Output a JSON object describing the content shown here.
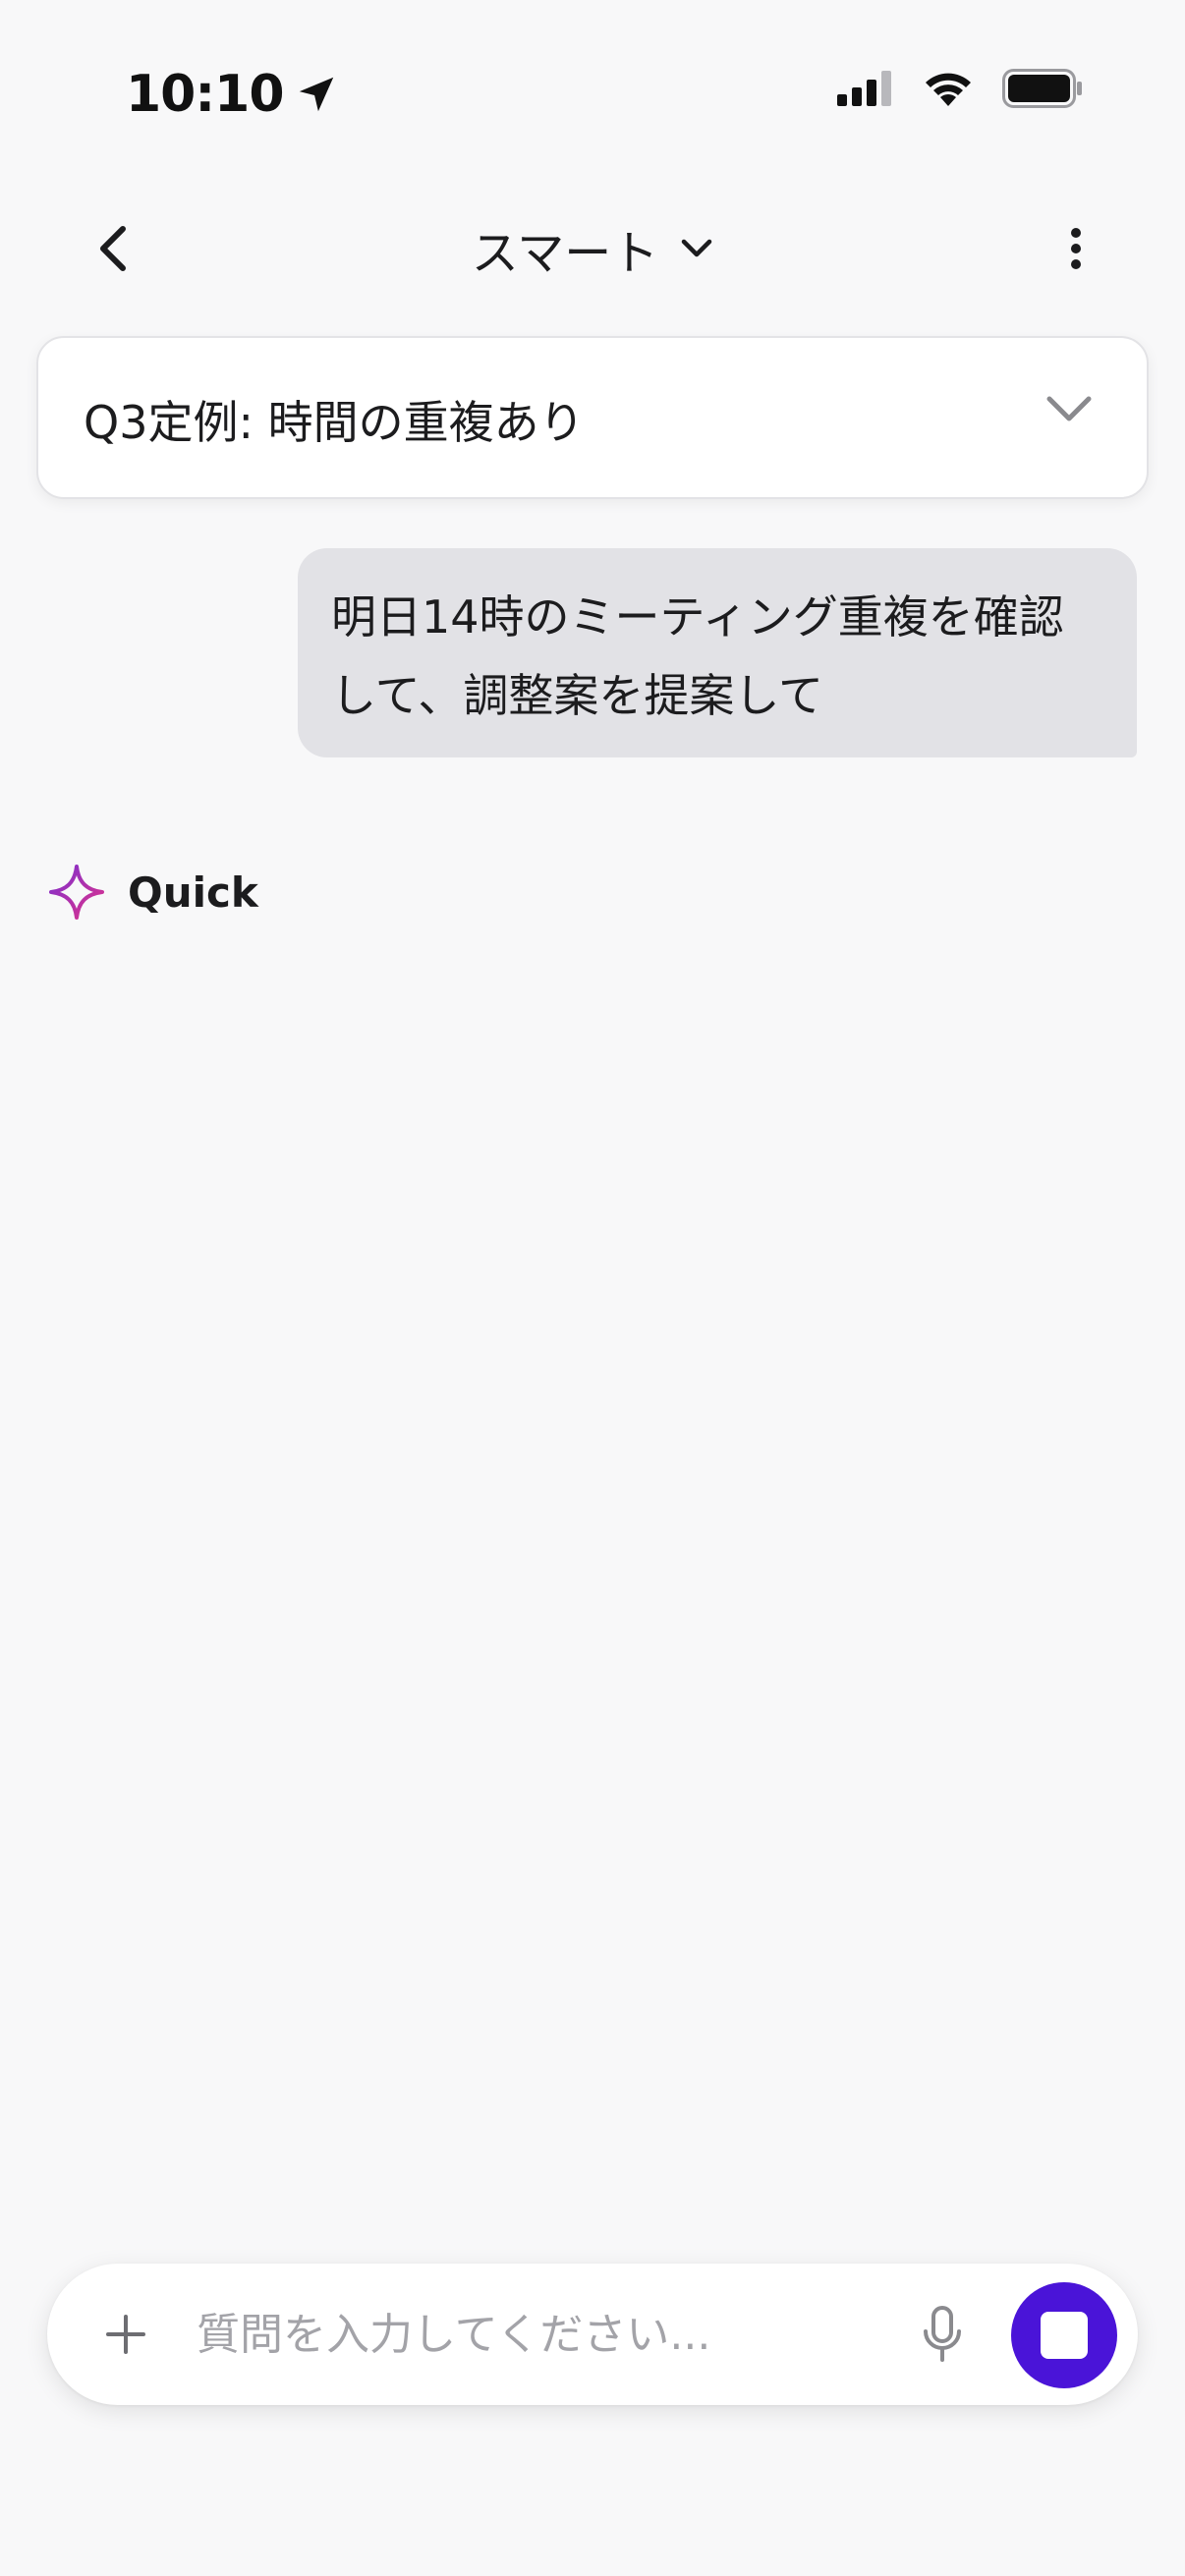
{
  "status_bar": {
    "time": "10:10",
    "icons": [
      "location-arrow-icon",
      "cellular-signal-icon",
      "wifi-icon",
      "battery-icon"
    ]
  },
  "nav": {
    "title": "スマート",
    "icons": [
      "chevron-left-icon",
      "chevron-down-icon",
      "more-vertical-icon"
    ]
  },
  "topic_card": {
    "title": "Q3定例: 時間の重複あり"
  },
  "conversation": {
    "user_message_line1": "明日14時のミーティング重複を確認",
    "user_message_line2": "して、調整案を提案して",
    "assistant_name": "Quick"
  },
  "input": {
    "placeholder": "質問を入力してください..."
  },
  "colors": {
    "accent": "#4a14d8",
    "bubble": "#e2e2e6",
    "background": "#f8f8f9",
    "sparkle_start": "#7b2fd0",
    "sparkle_end": "#e0338a"
  }
}
